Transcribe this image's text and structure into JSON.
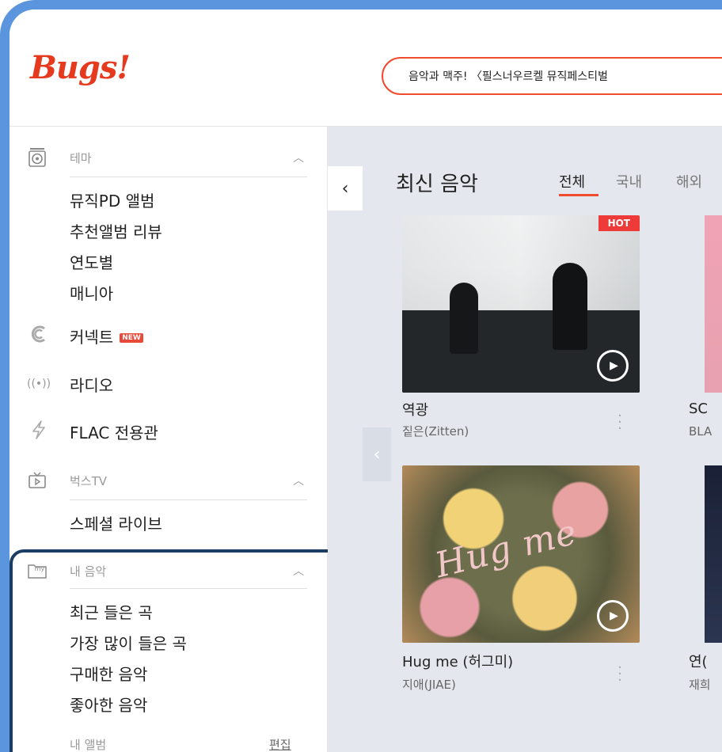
{
  "header": {
    "logo": "Bugs!",
    "search_text": "음악과 맥주! 〈필스너우르켈 뮤직페스티벌"
  },
  "sidebar": {
    "theme": {
      "label": "테마",
      "items": [
        "뮤직PD 앨범",
        "추천앨범 리뷰",
        "연도별",
        "매니아"
      ]
    },
    "connect": {
      "label": "커넥트",
      "badge": "NEW"
    },
    "radio": {
      "label": "라디오"
    },
    "flac": {
      "label": "FLAC 전용관"
    },
    "bugstv": {
      "label": "벅스TV",
      "items": [
        "스페셜 라이브"
      ]
    },
    "mymusic": {
      "label": "내 음악",
      "icon_text": "my",
      "items": [
        "최근 들은 곡",
        "가장 많이 들은 곡",
        "구매한 음악",
        "좋아한 음악"
      ],
      "album_label": "내 앨범",
      "edit_label": "편집"
    }
  },
  "main": {
    "title": "최신 음악",
    "tabs": [
      "전체",
      "국내",
      "해외"
    ],
    "cards": [
      {
        "title": "역광",
        "artist": "짙은(Zitten)",
        "badge": "HOT"
      },
      {
        "title": "Hug me (허그미)",
        "artist": "지애(JIAE)",
        "cover_text": "Hug me"
      }
    ],
    "partial_cards": [
      {
        "title": "SC",
        "artist": "BLA"
      },
      {
        "title": "연(",
        "artist": "재희"
      }
    ]
  },
  "colors": {
    "accent": "#ef4b2f",
    "frame": "#5b95dd",
    "highlight_box": "#1c3d63"
  }
}
